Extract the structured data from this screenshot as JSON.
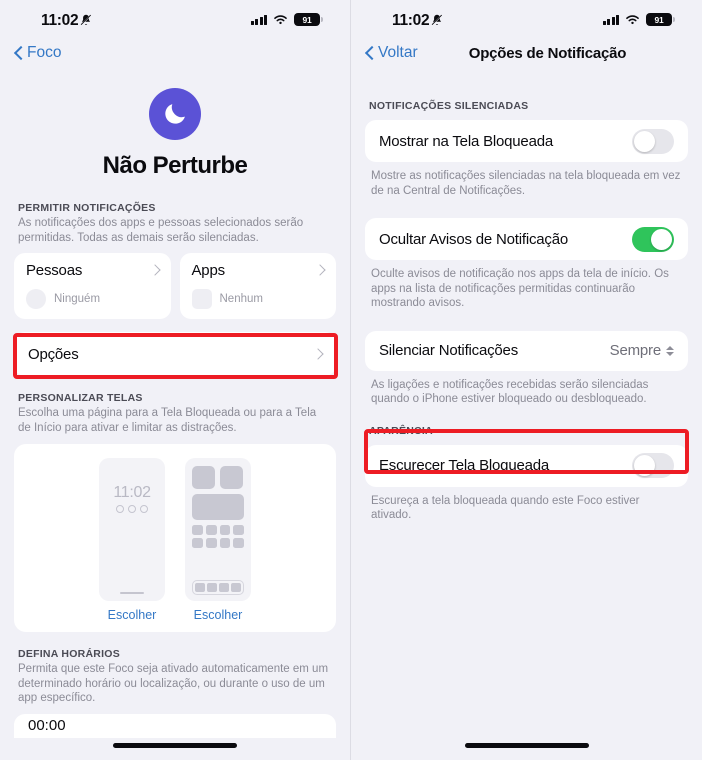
{
  "status_bar": {
    "time": "11:02",
    "battery": "91",
    "bell_icon": "bell-slash-icon",
    "signal_icon": "cellular-signal-icon",
    "wifi_icon": "wifi-icon"
  },
  "left_screen": {
    "back_label": "Foco",
    "hero": {
      "icon": "crescent-moon-icon",
      "title": "Não Perturbe",
      "accent_color": "#5b52d6"
    },
    "allow_section": {
      "header": "PERMITIR NOTIFICAÇÕES",
      "subtitle": "As notificações dos apps e pessoas selecionados serão permitidas. Todas as demais serão silenciadas.",
      "people_card": {
        "label": "Pessoas",
        "value": "Ninguém"
      },
      "apps_card": {
        "label": "Apps",
        "value": "Nenhum"
      }
    },
    "options_row": {
      "label": "Opções",
      "highlighted": true
    },
    "screens_section": {
      "header": "PERSONALIZAR TELAS",
      "subtitle": "Escolha uma página para a Tela Bloqueada ou para a Tela de Início para ativar e limitar as distrações.",
      "lock_preview_time": "11:02",
      "lock_choose_label": "Escolher",
      "home_choose_label": "Escolher"
    },
    "schedule_section": {
      "header": "DEFINA HORÁRIOS",
      "subtitle": "Permita que este Foco seja ativado automaticamente em um determinado horário ou localização, ou durante o uso de um app específico.",
      "partial_row": "00:00"
    }
  },
  "right_screen": {
    "back_label": "Voltar",
    "title": "Opções de Notificação",
    "silenced_section": {
      "header": "NOTIFICAÇÕES SILENCIADAS",
      "rows": [
        {
          "label": "Mostrar na Tela Bloqueada",
          "toggle": "off",
          "footnote": "Mostre as notificações silenciadas na tela bloqueada em vez de na Central de Notificações."
        },
        {
          "label": "Ocultar Avisos de Notificação",
          "toggle": "on",
          "footnote": "Oculte avisos de notificação nos apps da tela de início. Os apps na lista de notificações permitidas continuarão mostrando avisos."
        }
      ],
      "mute_row": {
        "label": "Silenciar Notificações",
        "value": "Sempre",
        "footnote": "As ligações e notificações recebidas serão silenciadas quando o iPhone estiver bloqueado ou desbloqueado."
      }
    },
    "appearance_section": {
      "header": "APARÊNCIA",
      "row": {
        "label": "Escurecer Tela Bloqueada",
        "toggle": "off",
        "highlighted": true,
        "footnote": "Escureça a tela bloqueada quando este Foco estiver ativado."
      }
    }
  },
  "colors": {
    "background": "#f1f1f7",
    "card": "#ffffff",
    "link": "#3478c6",
    "toggle_on": "#2fc45b",
    "highlight": "#ed1c24"
  }
}
